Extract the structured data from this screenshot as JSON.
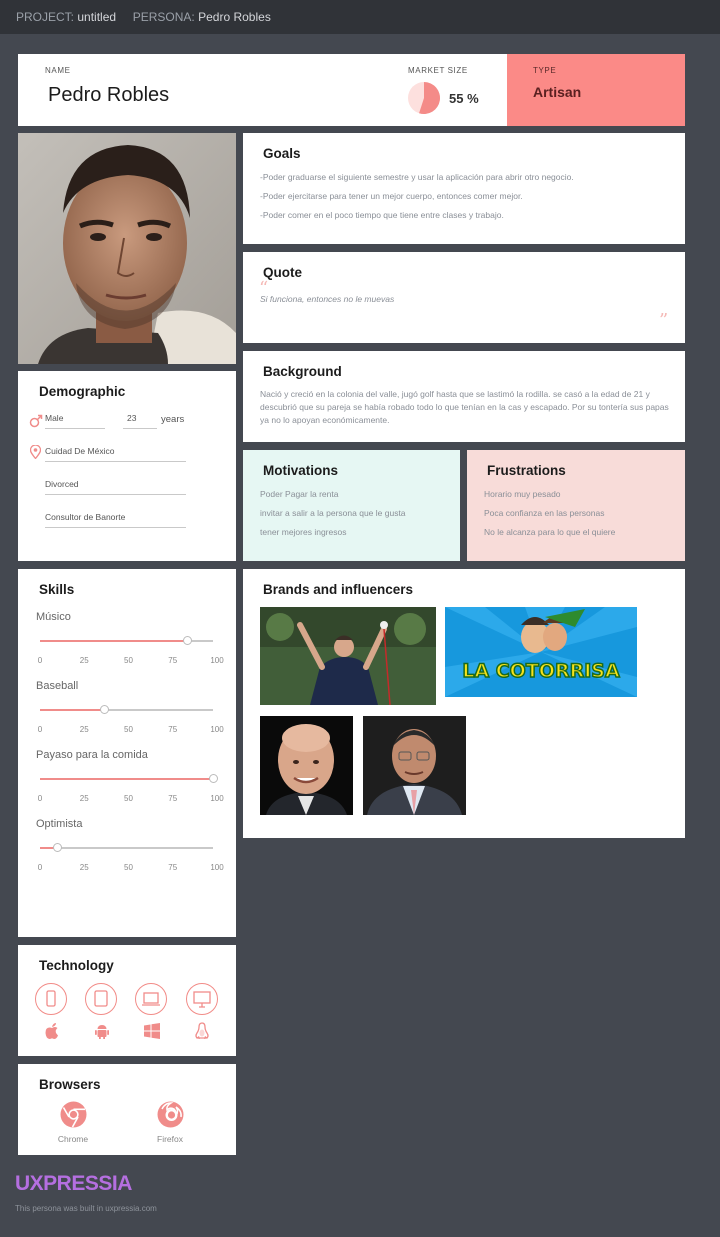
{
  "topbar": {
    "project_label": "PROJECT:",
    "project_value": "untitled",
    "persona_label": "PERSONA:",
    "persona_value": "Pedro Robles"
  },
  "header": {
    "name_label": "NAME",
    "name": "Pedro Robles",
    "market_label": "MARKET SIZE",
    "market_value": "55 %",
    "market_fraction": 0.55,
    "type_label": "TYPE",
    "type_value": "Artisan"
  },
  "goals": {
    "title": "Goals",
    "items": [
      "-Poder graduarse el siguiente semestre y usar la aplicación para abrir otro negocio.",
      "-Poder ejercitarse para tener un mejor cuerpo, entonces comer mejor.",
      "-Poder comer en el poco tiempo que tiene entre clases y trabajo."
    ]
  },
  "quote": {
    "title": "Quote",
    "text": "Si funciona, entonces no le muevas",
    "open_mark": "“",
    "close_mark": "”"
  },
  "background": {
    "title": "Background",
    "text": "Nació y creció en la colonia del valle, jugó golf hasta que se lastimó la rodilla. se casó a la edad de 21 y descubrió que su pareja se había robado todo lo que tenían en la cas y escapado. Por su tontería sus papas ya no lo apoyan económicamente."
  },
  "motivations": {
    "title": "Motivations",
    "items": [
      "Poder Pagar la renta",
      "invitar a salir a la persona que le gusta",
      "tener mejores ingresos"
    ]
  },
  "frustrations": {
    "title": "Frustrations",
    "items": [
      "Horario muy pesado",
      "Poca confianza en las personas",
      "No le alcanza para lo que el quiere"
    ]
  },
  "demographic": {
    "title": "Demographic",
    "gender": "Male",
    "age": "23",
    "age_unit": "years",
    "location": "Cuidad De México",
    "status": "Divorced",
    "occupation": "Consultor de Banorte"
  },
  "skills": {
    "title": "Skills",
    "ticks": [
      "0",
      "25",
      "50",
      "75",
      "100"
    ],
    "items": [
      {
        "name": "Músico",
        "value": 85
      },
      {
        "name": "Baseball",
        "value": 37
      },
      {
        "name": "Payaso para la comida",
        "value": 100
      },
      {
        "name": "Optimista",
        "value": 10
      }
    ]
  },
  "brands": {
    "title": "Brands and influencers",
    "logo_text": "LA COTORRISA"
  },
  "technology": {
    "title": "Technology",
    "devices": [
      "mobile-icon",
      "tablet-icon",
      "laptop-icon",
      "desktop-icon"
    ],
    "os": [
      "apple-icon",
      "android-icon",
      "windows-icon",
      "linux-icon"
    ]
  },
  "browsers": {
    "title": "Browsers",
    "items": [
      "Chrome",
      "Firefox"
    ]
  },
  "footer": {
    "brand": "UXPRESSIA",
    "note": "This persona was built in uxpressia.com"
  },
  "colors": {
    "accent": "#f08c8a",
    "type_bg": "#fb8a87",
    "motivations_bg": "#e6f7f3",
    "frustrations_bg": "#f8dcd9",
    "brand_purple": "#b56fe0",
    "background": "#444850"
  }
}
